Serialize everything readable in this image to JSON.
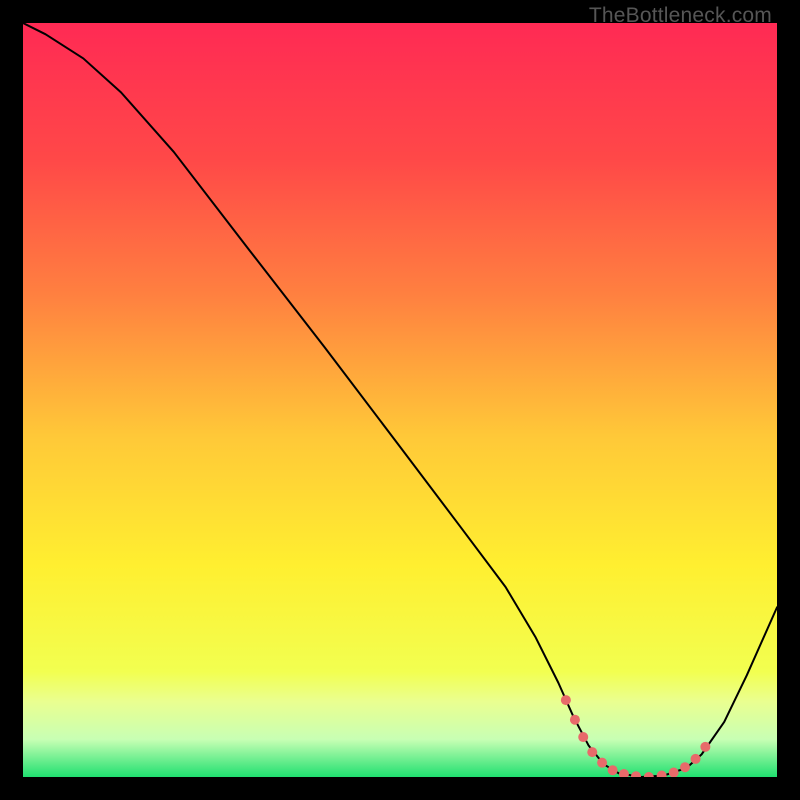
{
  "watermark": "TheBottleneck.com",
  "chart_data": {
    "type": "line",
    "title": "",
    "xlabel": "",
    "ylabel": "",
    "xlim": [
      0,
      100
    ],
    "ylim": [
      0,
      100
    ],
    "gradient_stops": [
      {
        "offset": 0,
        "color": "#ff2a54"
      },
      {
        "offset": 18,
        "color": "#ff4848"
      },
      {
        "offset": 36,
        "color": "#ff8040"
      },
      {
        "offset": 55,
        "color": "#ffc938"
      },
      {
        "offset": 72,
        "color": "#ffef30"
      },
      {
        "offset": 86,
        "color": "#f2ff50"
      },
      {
        "offset": 90,
        "color": "#eaff90"
      },
      {
        "offset": 95,
        "color": "#c8ffb4"
      },
      {
        "offset": 100,
        "color": "#20e070"
      }
    ],
    "series": [
      {
        "name": "curve",
        "color": "#000000",
        "width": 2,
        "points": [
          {
            "x": 0,
            "y": 100
          },
          {
            "x": 3,
            "y": 98.5
          },
          {
            "x": 8,
            "y": 95.3
          },
          {
            "x": 13,
            "y": 90.8
          },
          {
            "x": 20,
            "y": 82.9
          },
          {
            "x": 30,
            "y": 69.9
          },
          {
            "x": 40,
            "y": 57.0
          },
          {
            "x": 50,
            "y": 43.8
          },
          {
            "x": 58,
            "y": 33.2
          },
          {
            "x": 64,
            "y": 25.2
          },
          {
            "x": 68,
            "y": 18.5
          },
          {
            "x": 71,
            "y": 12.5
          },
          {
            "x": 73,
            "y": 8.0
          },
          {
            "x": 75,
            "y": 4.2
          },
          {
            "x": 77,
            "y": 1.7
          },
          {
            "x": 79,
            "y": 0.5
          },
          {
            "x": 82,
            "y": 0.0
          },
          {
            "x": 85,
            "y": 0.2
          },
          {
            "x": 88,
            "y": 1.2
          },
          {
            "x": 90,
            "y": 3.0
          },
          {
            "x": 93,
            "y": 7.3
          },
          {
            "x": 96,
            "y": 13.5
          },
          {
            "x": 100,
            "y": 22.5
          }
        ]
      }
    ],
    "markers": {
      "name": "highlight-dots",
      "color": "#e86a6a",
      "radius": 5,
      "points": [
        {
          "x": 72.0,
          "y": 10.2
        },
        {
          "x": 73.2,
          "y": 7.6
        },
        {
          "x": 74.3,
          "y": 5.3
        },
        {
          "x": 75.5,
          "y": 3.3
        },
        {
          "x": 76.8,
          "y": 1.9
        },
        {
          "x": 78.2,
          "y": 0.9
        },
        {
          "x": 79.7,
          "y": 0.4
        },
        {
          "x": 81.3,
          "y": 0.1
        },
        {
          "x": 83.0,
          "y": 0.0
        },
        {
          "x": 84.7,
          "y": 0.2
        },
        {
          "x": 86.3,
          "y": 0.6
        },
        {
          "x": 87.8,
          "y": 1.3
        },
        {
          "x": 89.2,
          "y": 2.4
        },
        {
          "x": 90.5,
          "y": 4.0
        }
      ]
    }
  }
}
